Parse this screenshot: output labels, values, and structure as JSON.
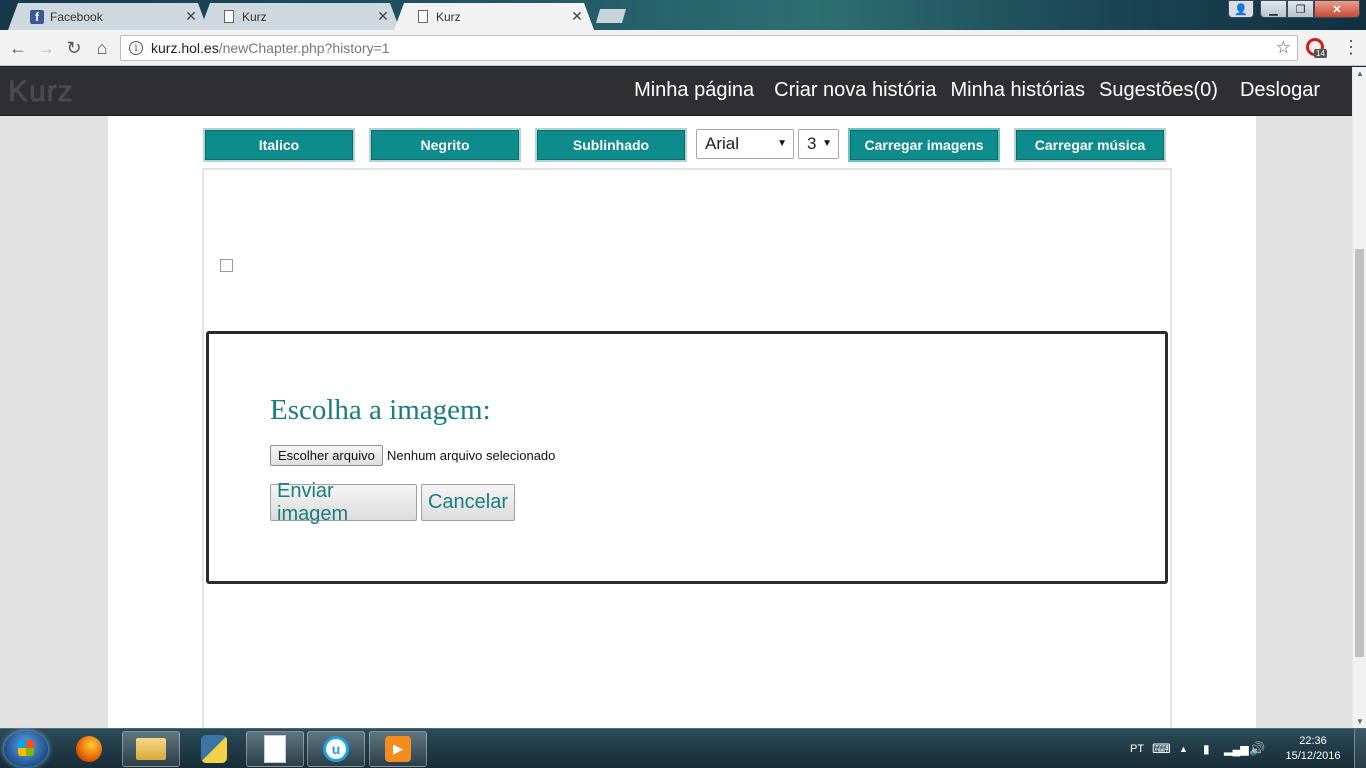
{
  "browser": {
    "tabs": [
      {
        "title": "Facebook",
        "icon": "facebook-icon"
      },
      {
        "title": "Kurz",
        "icon": "page-icon"
      },
      {
        "title": "Kurz",
        "icon": "page-icon",
        "active": true
      }
    ],
    "url_host": "kurz.hol.es",
    "url_path": "/newChapter.php?history=1",
    "extension_badge": "14"
  },
  "site": {
    "logo": "Kurz",
    "nav": [
      "Minha página",
      "Criar nova história",
      "Minha histórias",
      "Sugestões(0)",
      "Deslogar"
    ]
  },
  "toolbar": {
    "italic": "Italico",
    "bold": "Negrito",
    "underline": "Sublinhado",
    "font_select": "Arial",
    "size_select": "3",
    "upload_images": "Carregar imagens",
    "upload_music": "Carregar música"
  },
  "dialog": {
    "title": "Escolha a imagem:",
    "file_button": "Escolher arquivo",
    "file_status": "Nenhum arquivo selecionado",
    "submit": "Enviar imagem",
    "cancel": "Cancelar"
  },
  "taskbar": {
    "language": "PT",
    "time": "22:36",
    "date": "15/12/2016"
  },
  "colors": {
    "accent": "#0e8b8b",
    "header_bg": "#2f2f31",
    "dialog_text": "#1a7e7e"
  }
}
